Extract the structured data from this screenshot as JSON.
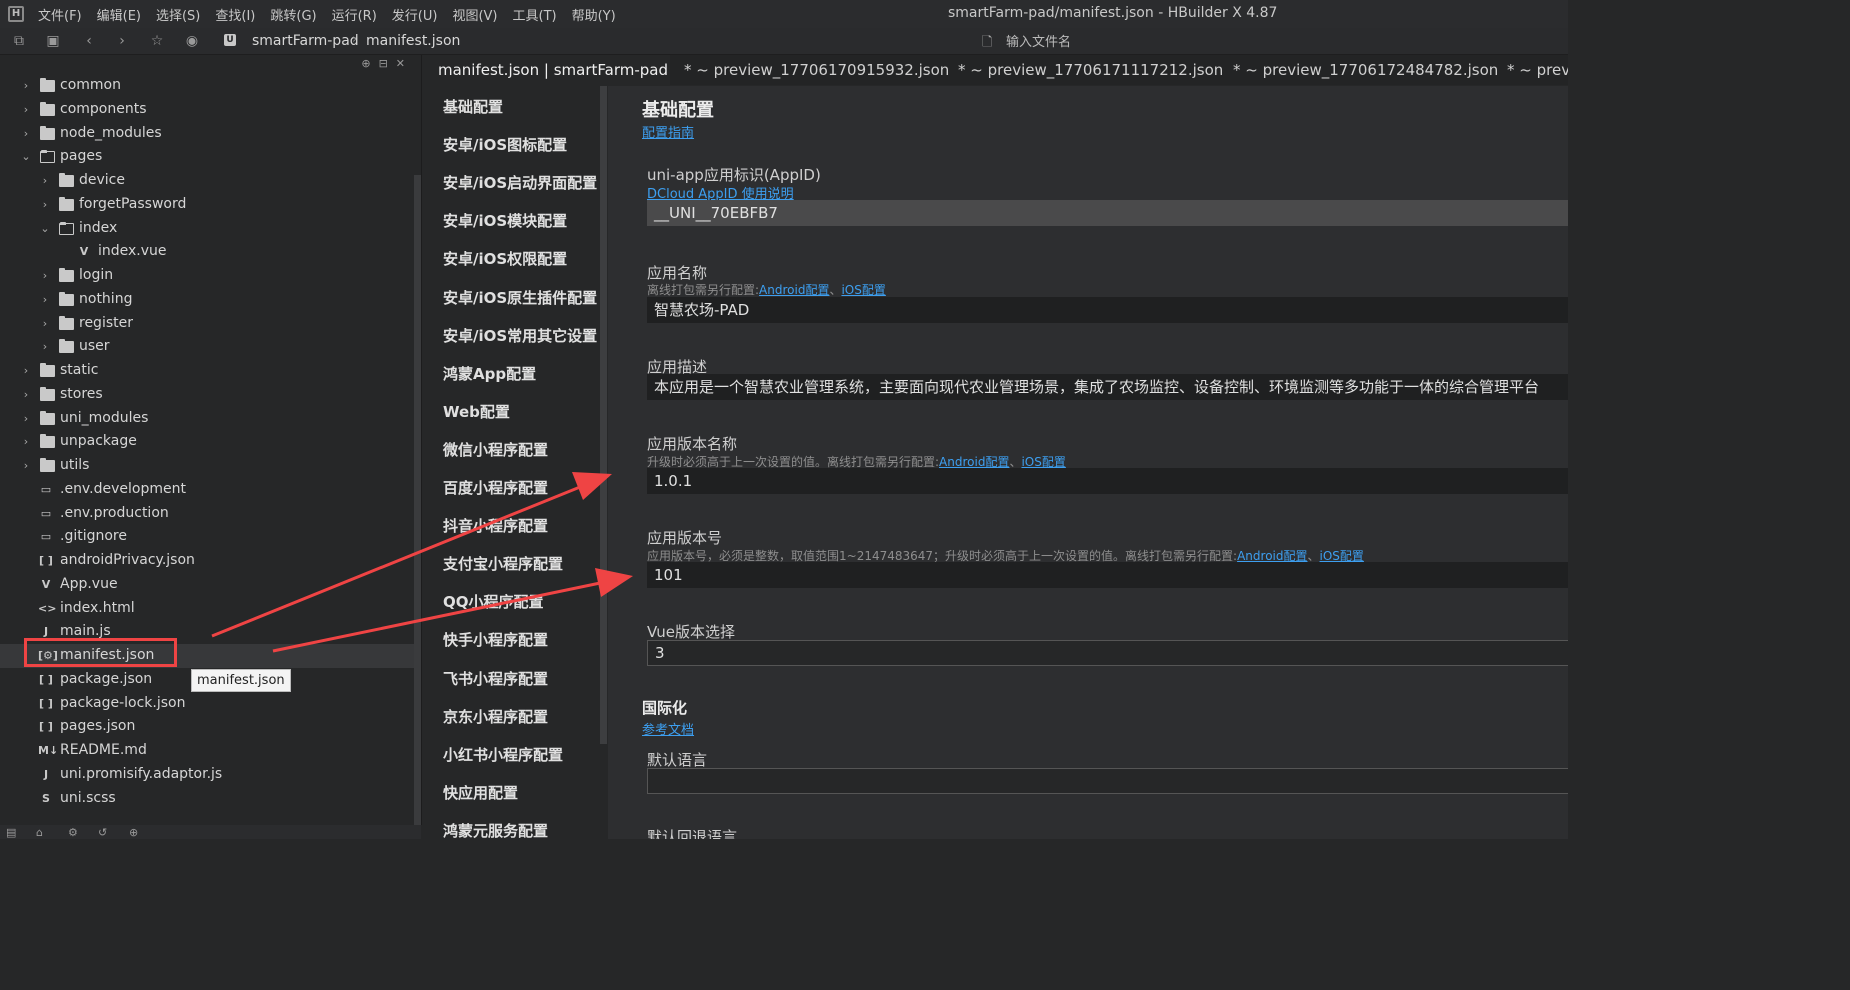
{
  "menubar": {
    "items": [
      "文件(F)",
      "编辑(E)",
      "选择(S)",
      "查找(I)",
      "跳转(G)",
      "运行(R)",
      "发行(U)",
      "视图(V)",
      "工具(T)",
      "帮助(Y)"
    ],
    "title": "smartFarm-pad/manifest.json - HBuilder X 4.87"
  },
  "toolbar": {
    "breadcrumb_root": "smartFarm-pad",
    "breadcrumb_file": "manifest.json",
    "search_placeholder": "输入文件名"
  },
  "tree": [
    {
      "label": "common",
      "type": "folder",
      "depth": 1,
      "expanded": false
    },
    {
      "label": "components",
      "type": "folder",
      "depth": 1,
      "expanded": false
    },
    {
      "label": "node_modules",
      "type": "folder",
      "depth": 1,
      "expanded": false
    },
    {
      "label": "pages",
      "type": "folder",
      "depth": 1,
      "expanded": true
    },
    {
      "label": "device",
      "type": "folder",
      "depth": 2,
      "expanded": false
    },
    {
      "label": "forgetPassword",
      "type": "folder",
      "depth": 2,
      "expanded": false
    },
    {
      "label": "index",
      "type": "folder",
      "depth": 2,
      "expanded": true
    },
    {
      "label": "index.vue",
      "type": "vue",
      "depth": 3
    },
    {
      "label": "login",
      "type": "folder",
      "depth": 2,
      "expanded": false
    },
    {
      "label": "nothing",
      "type": "folder",
      "depth": 2,
      "expanded": false
    },
    {
      "label": "register",
      "type": "folder",
      "depth": 2,
      "expanded": false
    },
    {
      "label": "user",
      "type": "folder",
      "depth": 2,
      "expanded": false
    },
    {
      "label": "static",
      "type": "folder",
      "depth": 1,
      "expanded": false
    },
    {
      "label": "stores",
      "type": "folder",
      "depth": 1,
      "expanded": false
    },
    {
      "label": "uni_modules",
      "type": "folder",
      "depth": 1,
      "expanded": false
    },
    {
      "label": "unpackage",
      "type": "folder",
      "depth": 1,
      "expanded": false
    },
    {
      "label": "utils",
      "type": "folder",
      "depth": 1,
      "expanded": false
    },
    {
      "label": ".env.development",
      "type": "file",
      "depth": 1
    },
    {
      "label": ".env.production",
      "type": "file",
      "depth": 1
    },
    {
      "label": ".gitignore",
      "type": "file",
      "depth": 1
    },
    {
      "label": "androidPrivacy.json",
      "type": "json",
      "depth": 1
    },
    {
      "label": "App.vue",
      "type": "vue",
      "depth": 1
    },
    {
      "label": "index.html",
      "type": "html",
      "depth": 1
    },
    {
      "label": "main.js",
      "type": "js",
      "depth": 1
    },
    {
      "label": "manifest.json",
      "type": "manifest",
      "depth": 1,
      "selected": true
    },
    {
      "label": "package.json",
      "type": "json",
      "depth": 1
    },
    {
      "label": "package-lock.json",
      "type": "json",
      "depth": 1
    },
    {
      "label": "pages.json",
      "type": "json",
      "depth": 1
    },
    {
      "label": "README.md",
      "type": "md",
      "depth": 1
    },
    {
      "label": "uni.promisify.adaptor.js",
      "type": "js",
      "depth": 1
    },
    {
      "label": "uni.scss",
      "type": "scss",
      "depth": 1
    }
  ],
  "tooltip": "manifest.json",
  "tabs": [
    {
      "label": "manifest.json | smartFarm-pad",
      "active": true
    },
    {
      "label": "* ~ preview_17706170915932.json",
      "active": false
    },
    {
      "label": "* ~ preview_17706171117212.json",
      "active": false
    },
    {
      "label": "* ~ preview_17706172484782.json",
      "active": false
    },
    {
      "label": "* ~ previ",
      "active": false
    }
  ],
  "config_nav": [
    "基础配置",
    "安卓/iOS图标配置",
    "安卓/iOS启动界面配置",
    "安卓/iOS模块配置",
    "安卓/iOS权限配置",
    "安卓/iOS原生插件配置",
    "安卓/iOS常用其它设置",
    "鸿蒙App配置",
    "Web配置",
    "微信小程序配置",
    "百度小程序配置",
    "抖音小程序配置",
    "支付宝小程序配置",
    "QQ小程序配置",
    "快手小程序配置",
    "飞书小程序配置",
    "京东小程序配置",
    "小红书小程序配置",
    "快应用配置",
    "鸿蒙元服务配置"
  ],
  "form": {
    "section_basic": "基础配置",
    "guide_link": "配置指南",
    "appid": {
      "label": "uni-app应用标识(AppID)",
      "link": "DCloud AppID 使用说明",
      "value": "__UNI__70EBFB7"
    },
    "app_name": {
      "label": "应用名称",
      "hint": "离线打包需另行配置:",
      "link_android": "Android配置",
      "sep": "、",
      "link_ios": "iOS配置",
      "value": "智慧农场-PAD"
    },
    "app_desc": {
      "label": "应用描述",
      "value": "本应用是一个智慧农业管理系统，主要面向现代农业管理场景，集成了农场监控、设备控制、环境监测等多功能于一体的综合管理平台"
    },
    "version_name": {
      "label": "应用版本名称",
      "hint": "升级时必须高于上一次设置的值。离线打包需另行配置:",
      "link_android": "Android配置",
      "sep": "、",
      "link_ios": "iOS配置",
      "value": "1.0.1"
    },
    "version_code": {
      "label": "应用版本号",
      "hint": "应用版本号，必须是整数，取值范围1~2147483647；升级时必须高于上一次设置的值。离线打包需另行配置:",
      "link_android": "Android配置",
      "sep": "、",
      "link_ios": "iOS配置",
      "value": "101"
    },
    "vue_version": {
      "label": "Vue版本选择",
      "value": "3"
    },
    "section_i18n": "国际化",
    "doc_link": "参考文档",
    "default_lang": {
      "label": "默认语言",
      "value": ""
    },
    "fallback_lang": {
      "label": "默认回退语言"
    }
  },
  "colors": {
    "accent_link": "#3d9ff0",
    "annotation_red": "#ef4444",
    "background": "#262728"
  }
}
